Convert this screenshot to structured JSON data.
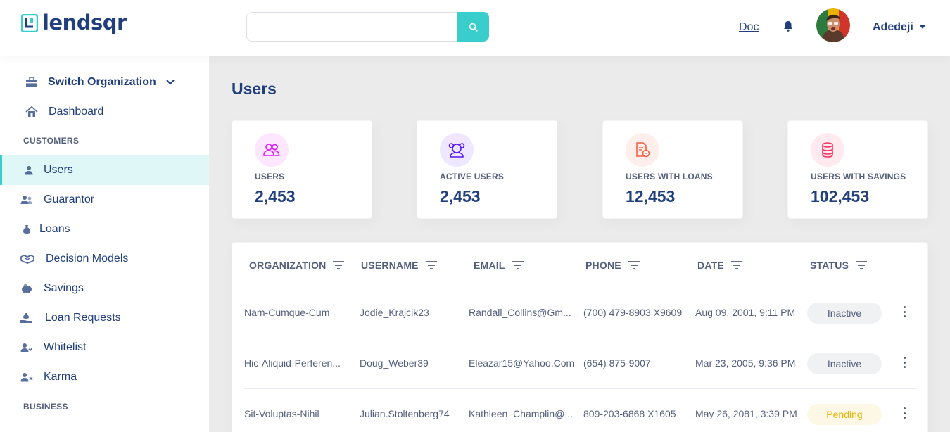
{
  "header": {
    "logo_text": "lendsqr",
    "search": {
      "value": "",
      "placeholder": ""
    },
    "doc_link": "Doc",
    "user_name": "Adedeji"
  },
  "sidebar": {
    "switch_org": "Switch Organization",
    "dashboard": "Dashboard",
    "sections": [
      {
        "label": "CUSTOMERS",
        "items": [
          {
            "label": "Users",
            "icon": "user-icon",
            "active": true
          },
          {
            "label": "Guarantor",
            "icon": "users-icon"
          },
          {
            "label": "Loans",
            "icon": "sack-icon"
          },
          {
            "label": "Decision Models",
            "icon": "handshake-icon"
          },
          {
            "label": "Savings",
            "icon": "piggy-bank-icon"
          },
          {
            "label": "Loan Requests",
            "icon": "hand-coin-icon"
          },
          {
            "label": "Whitelist",
            "icon": "user-check-icon"
          },
          {
            "label": "Karma",
            "icon": "user-x-icon"
          }
        ]
      },
      {
        "label": "BUSINESS",
        "items": []
      }
    ]
  },
  "main": {
    "title": "Users",
    "cards": [
      {
        "label": "USERS",
        "value": "2,453",
        "icon": "users-icon",
        "color": "#DF18FF"
      },
      {
        "label": "ACTIVE USERS",
        "value": "2,453",
        "icon": "active-users-icon",
        "color": "#5718FF"
      },
      {
        "label": "USERS WITH LOANS",
        "value": "12,453",
        "icon": "loan-document-icon",
        "color": "#F55F44"
      },
      {
        "label": "USERS WITH SAVINGS",
        "value": "102,453",
        "icon": "coins-icon",
        "color": "#FF3366"
      }
    ],
    "table": {
      "headers": [
        "ORGANIZATION",
        "USERNAME",
        "EMAIL",
        "PHONE",
        "DATE",
        "STATUS"
      ],
      "rows": [
        {
          "organization": "Nam-Cumque-Cum",
          "username": "Jodie_Krajcik23",
          "email": "Randall_Collins@Gm...",
          "phone": "(700) 479-8903 X9609",
          "date": "Aug 09, 2001, 9:11 PM",
          "status": "Inactive"
        },
        {
          "organization": "Hic-Aliquid-Perferen...",
          "username": "Doug_Weber39",
          "email": "Eleazar15@Yahoo.Com",
          "phone": "(654) 875-9007",
          "date": "Mar 23, 2005, 9:36 PM",
          "status": "Inactive"
        },
        {
          "organization": "Sit-Voluptas-Nihil",
          "username": "Julian.Stoltenberg74",
          "email": "Kathleen_Champlin@...",
          "phone": "809-203-6868 X1605",
          "date": "May 26, 2081, 3:39 PM",
          "status": "Pending"
        }
      ]
    }
  },
  "colors": {
    "accent": "#39CDCC",
    "primary": "#213F7D",
    "text_muted": "#545F7D",
    "pending": "#E9B200"
  }
}
